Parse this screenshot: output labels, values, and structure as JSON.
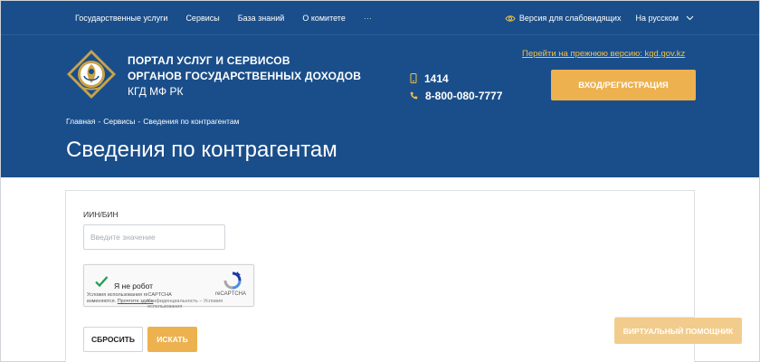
{
  "colors": {
    "header_bg": "#1a4e8a",
    "accent": "#edb14f",
    "link": "#f1c04a",
    "assistant_bg": "#f2cc8c"
  },
  "topnav": {
    "items": [
      "Государственные услуги",
      "Сервисы",
      "База знаний",
      "О комитете"
    ],
    "more": "···"
  },
  "topright": {
    "accessibility_label": "Версия для слабовидящих",
    "accessibility_icon": "eye-icon",
    "language_label": "На русском",
    "language_icon": "chevron-down-icon"
  },
  "header": {
    "org_line1": "ПОРТАЛ УСЛУГ И СЕРВИСОВ",
    "org_line2": "ОРГАНОВ ГОСУДАРСТВЕННЫХ ДОХОДОВ",
    "org_line3": "КГД МФ РК",
    "phone_short": "1414",
    "phone_short_icon": "mobile-phone-icon",
    "phone_long": "8-800-080-7777",
    "phone_long_icon": "phone-icon",
    "old_version_link": "Перейти на прежнюю версию: kgd.gov.kz",
    "login_button": "ВХОД/РЕГИСТРАЦИЯ"
  },
  "breadcrumb": {
    "items": [
      "Главная",
      "Сервисы",
      "Сведения по контрагентам"
    ],
    "separator": "-"
  },
  "page_title": "Сведения по контрагентам",
  "form": {
    "iin_label": "ИИН/БИН",
    "iin_value": "",
    "iin_placeholder": "Введите значение",
    "captcha": {
      "checkbox_label": "Я не робот",
      "brand": "reCAPTCHA",
      "terms_line1": "Условия использования reCAPTCHA",
      "terms_line2a": "изменяются.",
      "terms_line2b": "Прочтите здесь",
      "terms_line3": "Конфиденциальность – Условия использования"
    },
    "reset_button": "СБРОСИТЬ",
    "search_button": "ИСКАТЬ"
  },
  "assistant_button": "ВИРТУАЛЬНЫЙ ПОМОЩНИК"
}
